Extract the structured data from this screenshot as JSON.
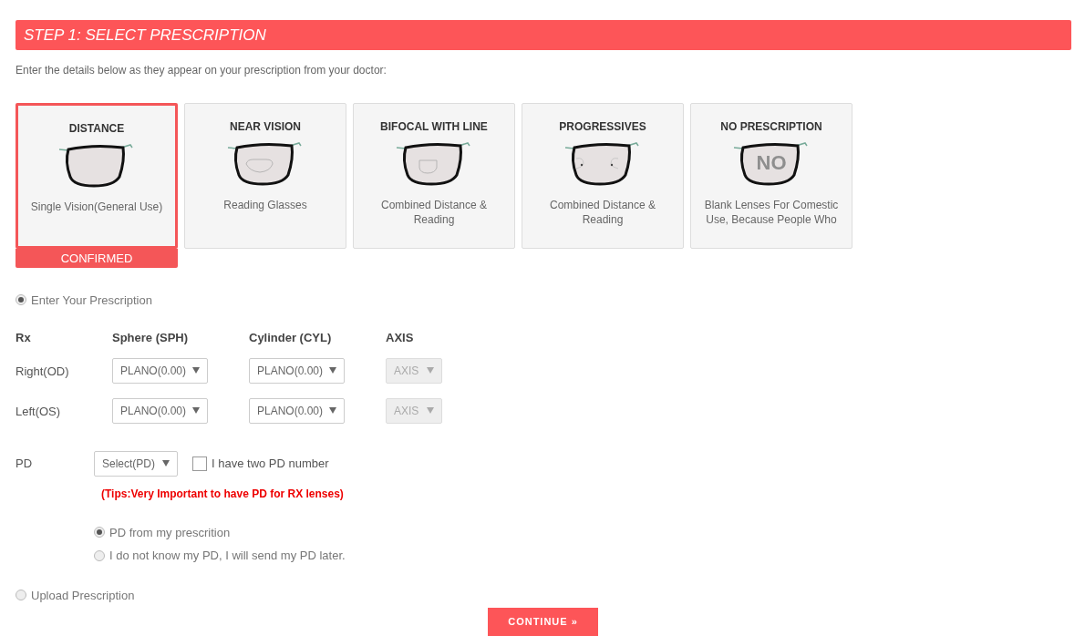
{
  "header": {
    "title": "STEP 1: SELECT PRESCRIPTION"
  },
  "intro": "Enter the details below as they appear on your prescription from your doctor:",
  "cards": [
    {
      "kind": "distance",
      "title": "DISTANCE",
      "description": "Single Vision(General Use)",
      "selected": true,
      "badge": "CONFIRMED"
    },
    {
      "kind": "near",
      "title": "NEAR VISION",
      "description": "Reading Glasses",
      "selected": false
    },
    {
      "kind": "bifocal",
      "title": "BIFOCAL WITH LINE",
      "description": "Combined Distance & Reading",
      "selected": false
    },
    {
      "kind": "progressive",
      "title": "PROGRESSIVES",
      "description": "Combined Distance & Reading",
      "selected": false
    },
    {
      "kind": "none",
      "title": "NO PRESCRIPTION",
      "description": "Blank Lenses For Comestic Use, Because People Who",
      "selected": false,
      "lens_label": "NO"
    }
  ],
  "enter_option": {
    "label": "Enter Your Prescription",
    "selected": true
  },
  "table": {
    "columns": [
      "Rx",
      "Sphere (SPH)",
      "Cylinder (CYL)",
      "AXIS"
    ],
    "rows": [
      {
        "cells": [
          {
            "kind": "label",
            "value": "Right(OD)"
          },
          {
            "kind": "select",
            "value": "PLANO(0.00)",
            "disabled": false
          },
          {
            "kind": "select",
            "value": "PLANO(0.00)",
            "disabled": false
          },
          {
            "kind": "select",
            "value": "AXIS",
            "disabled": true
          }
        ]
      },
      {
        "cells": [
          {
            "kind": "label",
            "value": "Left(OS)"
          },
          {
            "kind": "select",
            "value": "PLANO(0.00)",
            "disabled": false
          },
          {
            "kind": "select",
            "value": "PLANO(0.00)",
            "disabled": false
          },
          {
            "kind": "select",
            "value": "AXIS",
            "disabled": true
          }
        ]
      }
    ]
  },
  "pd": {
    "label": "PD",
    "select": "Select(PD)",
    "two_pd": {
      "label": "I have two PD number",
      "checked": false
    },
    "tip": "(Tips:Very Important to have PD for RX lenses)",
    "options": [
      {
        "label": "PD from my prescrition",
        "selected": true
      },
      {
        "label": "I do not know my PD, I will send my PD later.",
        "selected": false
      }
    ]
  },
  "upload_option": {
    "label": "Upload Prescription",
    "selected": false
  },
  "continue_button": "CONTINUE »"
}
